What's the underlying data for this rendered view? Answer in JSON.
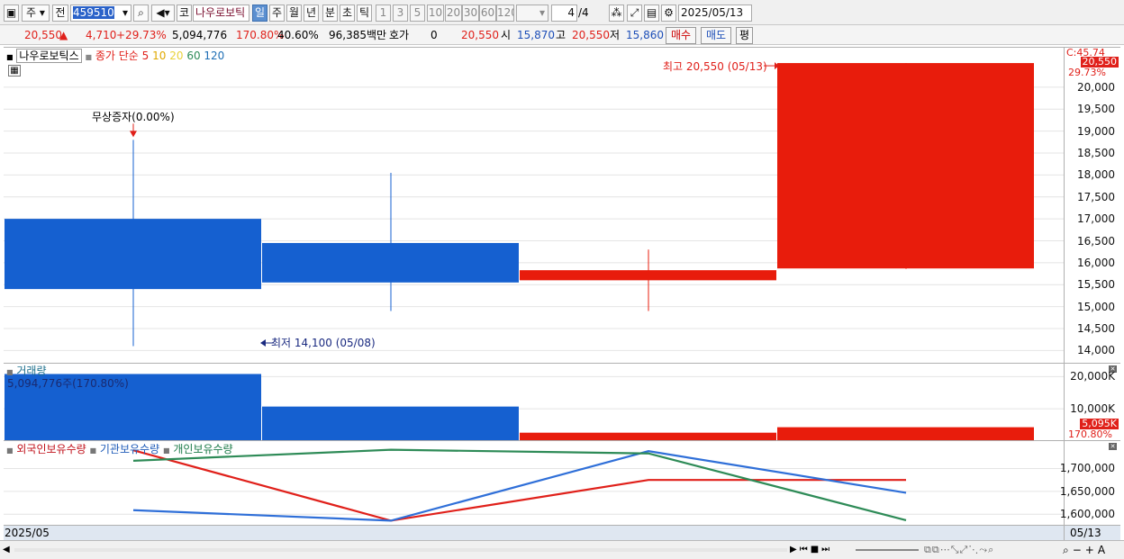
{
  "toolbar": {
    "mode": "주",
    "type": "전",
    "code": "459510",
    "market": "코",
    "name": "나우로보틱",
    "periods": [
      "일",
      "주",
      "월",
      "년",
      "분",
      "초",
      "틱"
    ],
    "selected_period": "일",
    "intervals": [
      "1",
      "3",
      "5",
      "10",
      "20",
      "30",
      "60",
      "120"
    ],
    "page": "4",
    "page_total": "/4",
    "date": "2025/05/13"
  },
  "infobar": {
    "price": "20,550",
    "change": "4,710",
    "change_pct": "+29.73%",
    "volume": "5,094,776",
    "volume_pct": "170.80%",
    "turnover": "40.60%",
    "amount": "96,385백만",
    "quote_label": "호가",
    "quote_value": "0",
    "quote_price": "20,550",
    "open_label": "시",
    "open": "15,870",
    "high_label": "고",
    "high": "20,550",
    "low_label": "저",
    "low": "15,860",
    "buy_label": "매수",
    "sell_label": "매도",
    "avg_label": "평"
  },
  "price_pane": {
    "stock_name": "나우로보틱스",
    "ma_label": "종가 단순",
    "ma_periods": [
      {
        "label": "5",
        "color": "#e0201a"
      },
      {
        "label": "10",
        "color": "#e0a800"
      },
      {
        "label": "20",
        "color": "#e8d23a"
      },
      {
        "label": "60",
        "color": "#2e8b57"
      },
      {
        "label": "120",
        "color": "#1f6fb5"
      }
    ],
    "event_label": "무상증자(0.00%)",
    "high_marker": "최고 20,550 (05/13)",
    "low_marker": "최저 14,100 (05/08)",
    "y_ticks": [
      "20,000",
      "19,500",
      "19,000",
      "18,500",
      "18,000",
      "17,500",
      "17,000",
      "16,500",
      "16,000",
      "15,500",
      "15,000",
      "14,500",
      "14,000"
    ],
    "top_tag_1": "C:45.74",
    "top_tag_2": "20,550",
    "top_tag_3": "29.73%"
  },
  "candles": [
    {
      "open": 17000,
      "close": 15400,
      "high": 18800,
      "low": 14100,
      "color": "#1560d0"
    },
    {
      "open": 16450,
      "close": 15550,
      "high": 18050,
      "low": 14900,
      "color": "#1560d0"
    },
    {
      "open": 15600,
      "close": 15830,
      "high": 16300,
      "low": 14900,
      "color": "#e81c0c"
    },
    {
      "open": 15870,
      "close": 20550,
      "high": 20550,
      "low": 15860,
      "color": "#e81c0c"
    }
  ],
  "volume_pane": {
    "title": "거래량",
    "value_label": "5,094,776주(170.80%)",
    "y_ticks": [
      "20,000K",
      "10,000K"
    ],
    "tag_1": "5,095K",
    "tag_2": "170.80%",
    "bars": [
      {
        "value": 20800,
        "color": "#1560d0"
      },
      {
        "value": 10700,
        "color": "#1560d0"
      },
      {
        "value": 2600,
        "color": "#e81c0c"
      },
      {
        "value": 4300,
        "color": "#e81c0c"
      }
    ]
  },
  "holdings_pane": {
    "legend": [
      "외국인보유수량",
      "기관보유수량",
      "개인보유수량"
    ],
    "legend_colors": [
      "#e0201a",
      "#2f6fd8",
      "#2e8b57"
    ],
    "y_ticks": [
      "1,700,000",
      "1,650,000",
      "1,600,000"
    ],
    "series": [
      {
        "name": "외국인보유수량",
        "color": "#e0201a",
        "values": [
          1740000,
          1586000,
          1675000,
          1675000
        ]
      },
      {
        "name": "기관보유수량",
        "color": "#2f6fd8",
        "values": [
          1609000,
          1586000,
          1738000,
          1647000
        ]
      },
      {
        "name": "개인보유수량",
        "color": "#2e8b57",
        "values": [
          1717000,
          1741000,
          1733000,
          1587000
        ]
      }
    ]
  },
  "datebar": {
    "left_label": "2025/05",
    "right_label": "05/13"
  }
}
